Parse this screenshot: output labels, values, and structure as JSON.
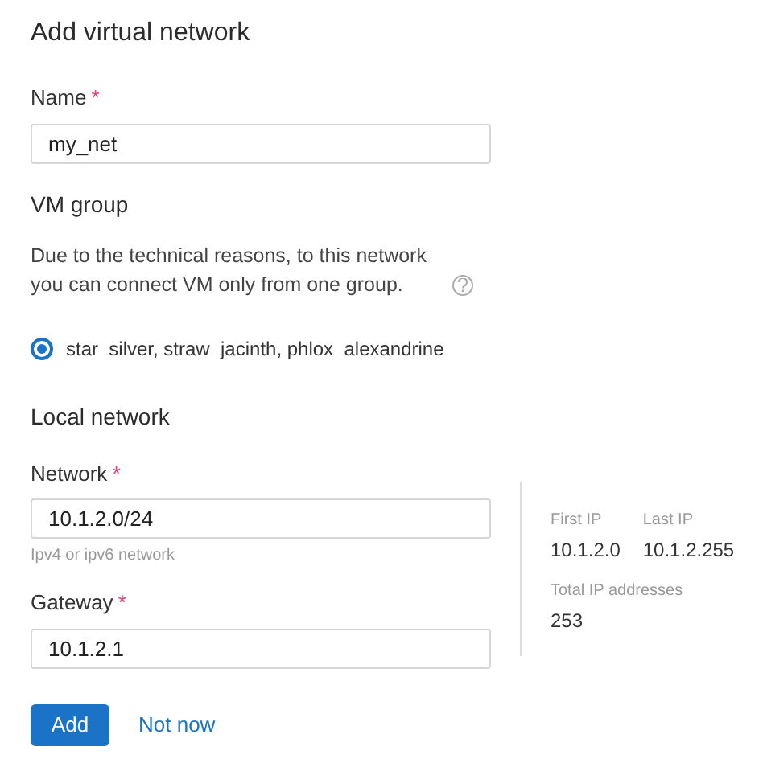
{
  "title": "Add virtual network",
  "name_field": {
    "label": "Name",
    "required_mark": "*",
    "value": "my_net"
  },
  "vm_group": {
    "heading": "VM group",
    "description": "Due to the technical reasons, to this network you can connect VM only from one group.",
    "options": [
      {
        "label": "star  silver, straw  jacinth, phlox  alexandrine",
        "selected": true
      }
    ]
  },
  "local_network": {
    "heading": "Local network",
    "network_field": {
      "label": "Network",
      "required_mark": "*",
      "value": "10.1.2.0/24",
      "hint": "Ipv4 or ipv6 network"
    },
    "gateway_field": {
      "label": "Gateway",
      "required_mark": "*",
      "value": "10.1.2.1"
    },
    "info": {
      "first_ip_label": "First IP",
      "first_ip": "10.1.2.0",
      "last_ip_label": "Last IP",
      "last_ip": "10.1.2.255",
      "total_label": "Total IP addresses",
      "total": "253"
    }
  },
  "buttons": {
    "primary": "Add",
    "secondary": "Not now"
  }
}
